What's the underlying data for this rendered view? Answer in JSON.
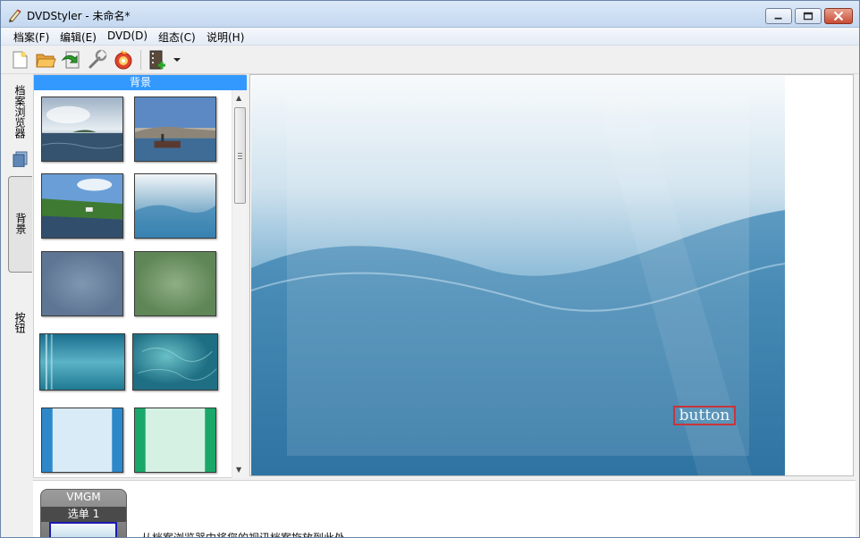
{
  "window": {
    "title": "DVDStyler - 未命名*",
    "buttons": {
      "minimize_icon": "minimize-icon",
      "maximize_icon": "maximize-icon",
      "close_icon": "close-icon"
    }
  },
  "menubar": {
    "items": [
      {
        "label": "档案(F)"
      },
      {
        "label": "编辑(E)"
      },
      {
        "label": "DVD(D)"
      },
      {
        "label": "组态(C)"
      },
      {
        "label": "说明(H)"
      }
    ]
  },
  "toolbar": {
    "items": [
      {
        "icon": "new-file-icon"
      },
      {
        "icon": "open-folder-icon"
      },
      {
        "icon": "save-icon"
      },
      {
        "icon": "settings-wrench-icon"
      },
      {
        "icon": "burn-disc-icon"
      },
      {
        "icon": "add-video-icon"
      },
      {
        "icon": "dropdown-arrow-icon"
      }
    ]
  },
  "side_tabs": [
    {
      "label": "档案浏览器",
      "icon": "file-browser-icon"
    },
    {
      "label": "背景"
    },
    {
      "label": "按钮"
    }
  ],
  "background_panel": {
    "header": "背景",
    "thumbnails": [
      {
        "name": "ocean-island"
      },
      {
        "name": "harbor-boat"
      },
      {
        "name": "river-coast"
      },
      {
        "name": "blue-waves"
      },
      {
        "name": "slate-blur"
      },
      {
        "name": "green-blur"
      },
      {
        "name": "teal-stripes"
      },
      {
        "name": "teal-texture"
      },
      {
        "name": "light-blue-frame"
      },
      {
        "name": "mint-frame"
      }
    ]
  },
  "canvas": {
    "button_label": "button",
    "colors": {
      "bg_top": "#f4f8fb",
      "bg_bottom": "#2d79a8",
      "button_border": "#c9343a"
    }
  },
  "titleset": {
    "vmgm_label": "VMGM",
    "menu_label": "选单 1",
    "drop_hint": "从档案浏览器中将您的视讯档案拖放到此处"
  }
}
